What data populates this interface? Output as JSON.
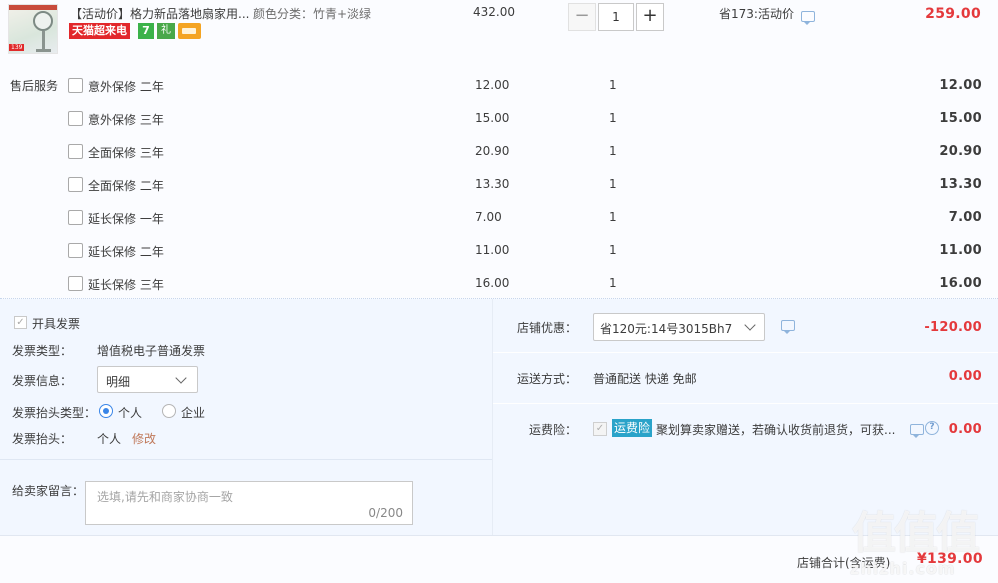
{
  "product": {
    "title": "【活动价】格力新品落地扇家用...",
    "sku": "颜色分类：竹青+淡绿",
    "badges": {
      "tmall": "天猫超来电",
      "seven": "7",
      "gift": "礼",
      "card_icon": "card-icon"
    },
    "unit_price": "432.00",
    "quantity": "1",
    "qty_minus": "−",
    "qty_plus": "+",
    "save_text": "省173:活动价",
    "total": "259.00"
  },
  "services": {
    "label": "售后服务",
    "items": [
      {
        "name": "意外保修 二年",
        "price": "12.00",
        "qty": "1",
        "total": "12.00"
      },
      {
        "name": "意外保修 三年",
        "price": "15.00",
        "qty": "1",
        "total": "15.00"
      },
      {
        "name": "全面保修 三年",
        "price": "20.90",
        "qty": "1",
        "total": "20.90"
      },
      {
        "name": "全面保修 二年",
        "price": "13.30",
        "qty": "1",
        "total": "13.30"
      },
      {
        "name": "延长保修 一年",
        "price": "7.00",
        "qty": "1",
        "total": "7.00"
      },
      {
        "name": "延长保修 二年",
        "price": "11.00",
        "qty": "1",
        "total": "11.00"
      },
      {
        "name": "延长保修 三年",
        "price": "16.00",
        "qty": "1",
        "total": "16.00"
      }
    ]
  },
  "invoice": {
    "open_label": "开具发票",
    "type_label": "发票类型：",
    "type_value": "增值税电子普通发票",
    "info_label": "发票信息：",
    "info_value": "明细",
    "header_type_label": "发票抬头类型：",
    "option_personal": "个人",
    "option_company": "企业",
    "header_label": "发票抬头：",
    "header_value": "个人",
    "modify": "修改"
  },
  "message": {
    "label": "给卖家留言：",
    "placeholder": "选填,请先和商家协商一致",
    "count": "0/200"
  },
  "shop": {
    "coupon_label": "店铺优惠：",
    "coupon_value": "省120元:14号3015Bh7",
    "coupon_amount": "-120.00",
    "shipping_label": "运送方式：",
    "shipping_value": "普通配送 快递 免邮",
    "shipping_amount": "0.00",
    "insurance_label": "运费险：",
    "insurance_badge": "运费险",
    "insurance_text": "聚划算卖家赠送，若确认收货前退货，可获...",
    "insurance_amount": "0.00"
  },
  "summary": {
    "label": "店铺合计(含运费)",
    "value": "¥139.00"
  },
  "watermark": {
    "main": "值值值",
    "sub": "zhizhi.com"
  },
  "colors": {
    "price_red": "#e4393c",
    "link_brown": "#c0795a",
    "radio_blue": "#3a86e8",
    "panel_bg": "#f2f7ff"
  }
}
